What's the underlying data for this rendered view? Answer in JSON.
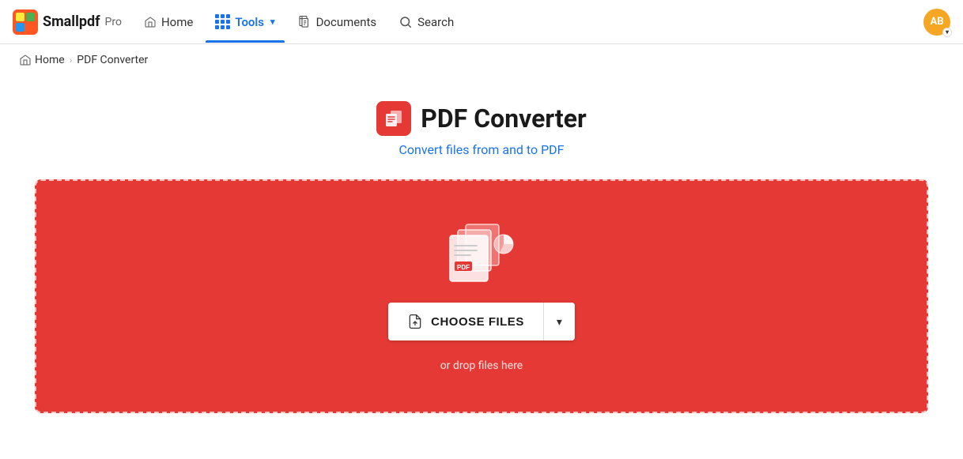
{
  "brand": {
    "logo_colors": [
      "#FF5722",
      "#FFEB3B",
      "#4CAF50",
      "#2196F3"
    ],
    "name": "Smallpdf",
    "pro_label": "Pro"
  },
  "nav": {
    "home_label": "Home",
    "tools_label": "Tools",
    "documents_label": "Documents",
    "search_label": "Search",
    "active_item": "tools"
  },
  "avatar": {
    "initials": "AB"
  },
  "breadcrumb": {
    "home": "Home",
    "separator": "›",
    "current": "PDF Converter"
  },
  "page": {
    "title": "PDF Converter",
    "subtitle": "Convert files from and to PDF"
  },
  "dropzone": {
    "button_label": "CHOOSE FILES",
    "drop_hint": "or drop files here"
  }
}
